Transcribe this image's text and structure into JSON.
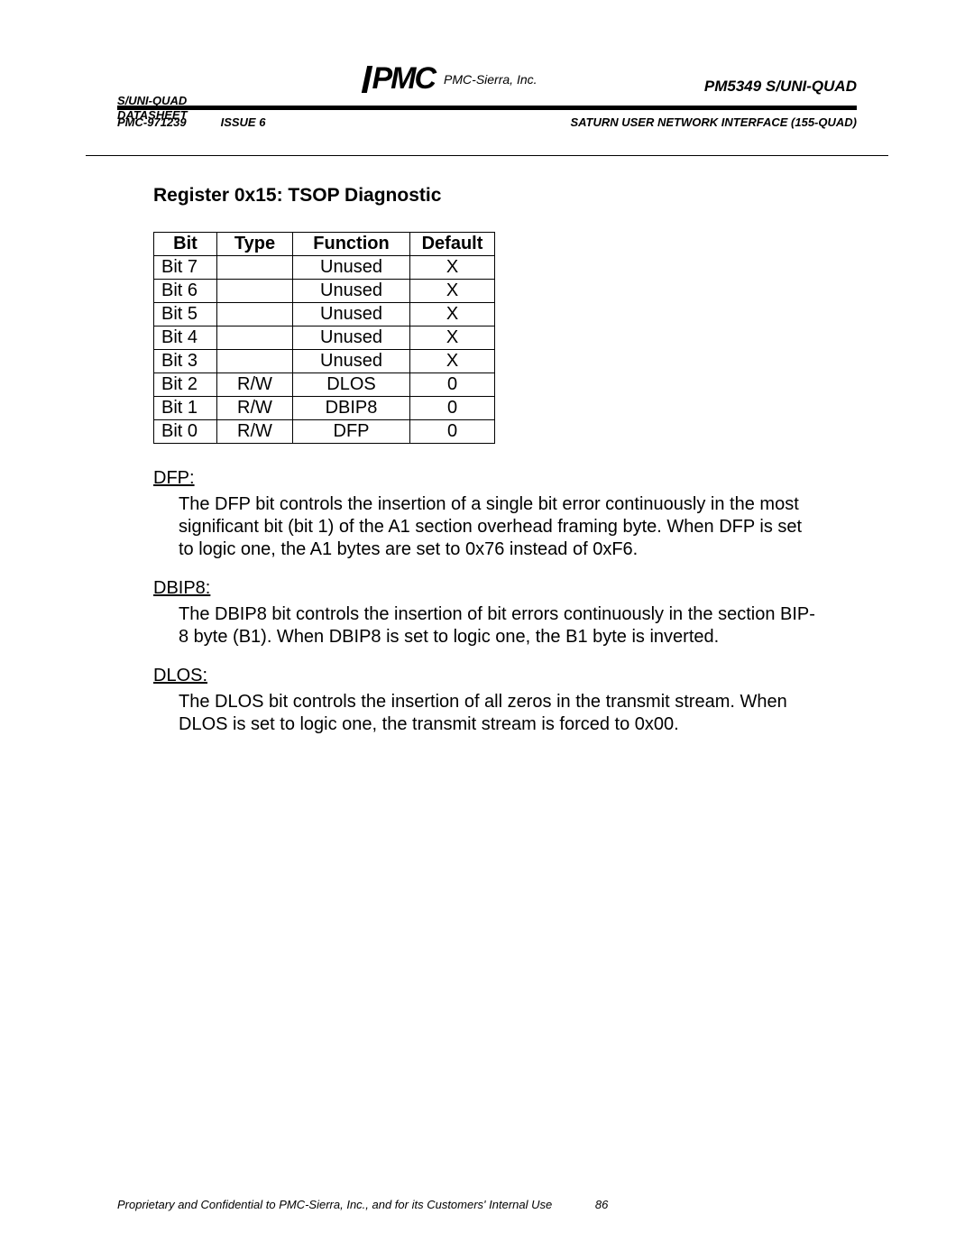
{
  "header": {
    "left_line1": "S/UNI-QUAD",
    "left_line2": "DATASHEET",
    "left_line3": "PMC-971239",
    "logo_company": "PMC-Sierra, Inc.",
    "right_product": "PM5349 S/UNI-QUAD",
    "issue": "ISSUE 6",
    "subtitle": "SATURN USER NETWORK INTERFACE (155-QUAD)"
  },
  "section_title": "Register 0x15: TSOP Diagnostic",
  "table": {
    "headers": {
      "bit": "Bit",
      "type": "Type",
      "func": "Function",
      "def": "Default"
    },
    "rows": [
      {
        "bit": "Bit 7",
        "type": "",
        "func": "Unused",
        "def": "X"
      },
      {
        "bit": "Bit 6",
        "type": "",
        "func": "Unused",
        "def": "X"
      },
      {
        "bit": "Bit 5",
        "type": "",
        "func": "Unused",
        "def": "X"
      },
      {
        "bit": "Bit 4",
        "type": "",
        "func": "Unused",
        "def": "X"
      },
      {
        "bit": "Bit 3",
        "type": "",
        "func": "Unused",
        "def": "X"
      },
      {
        "bit": "Bit 2",
        "type": "R/W",
        "func": "DLOS",
        "def": "0"
      },
      {
        "bit": "Bit 1",
        "type": "R/W",
        "func": "DBIP8",
        "def": "0"
      },
      {
        "bit": "Bit 0",
        "type": "R/W",
        "func": "DFP",
        "def": "0"
      }
    ]
  },
  "descriptions": [
    {
      "label": "DFP:",
      "body": "The DFP bit controls the insertion of a single bit error continuously in the most significant bit (bit 1) of the A1 section overhead framing byte.  When DFP is set to logic one, the A1 bytes are set to 0x76 instead of 0xF6."
    },
    {
      "label": "DBIP8:",
      "body": "The DBIP8 bit controls the insertion of bit errors continuously in the section BIP-8 byte (B1).  When DBIP8 is set to logic one, the B1 byte is inverted."
    },
    {
      "label": "DLOS:",
      "body": "The DLOS bit controls the insertion of all zeros in the transmit stream.  When DLOS is set to logic one, the transmit stream is forced to 0x00."
    }
  ],
  "footer": {
    "text": "Proprietary and Confidential to PMC-Sierra, Inc., and for its Customers' Internal Use",
    "page": "86"
  }
}
